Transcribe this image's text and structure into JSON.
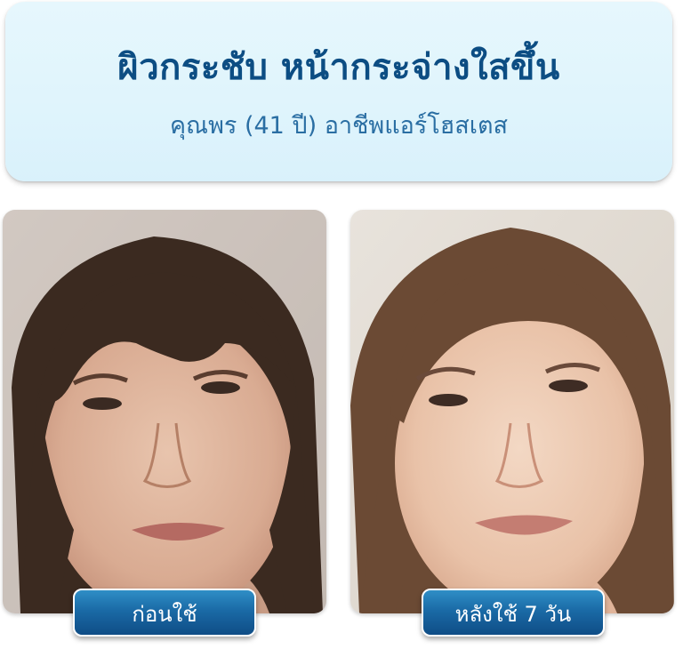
{
  "header": {
    "headline": "ผิวกระชับ หน้ากระจ่างใสขึ้น",
    "subline": "คุณพร (41 ปี) อาชีพแอร์โฮสเตส"
  },
  "photos": {
    "before": {
      "label": "ก่อนใช้",
      "image": "face-before-photo"
    },
    "after": {
      "label": "หลังใช้ 7 วัน",
      "image": "face-after-photo"
    }
  },
  "colors": {
    "headline": "#0c4d83",
    "subline": "#2a6ea3",
    "header_bg": "#e2f5fc",
    "label_bg": "#1a6aa6"
  }
}
